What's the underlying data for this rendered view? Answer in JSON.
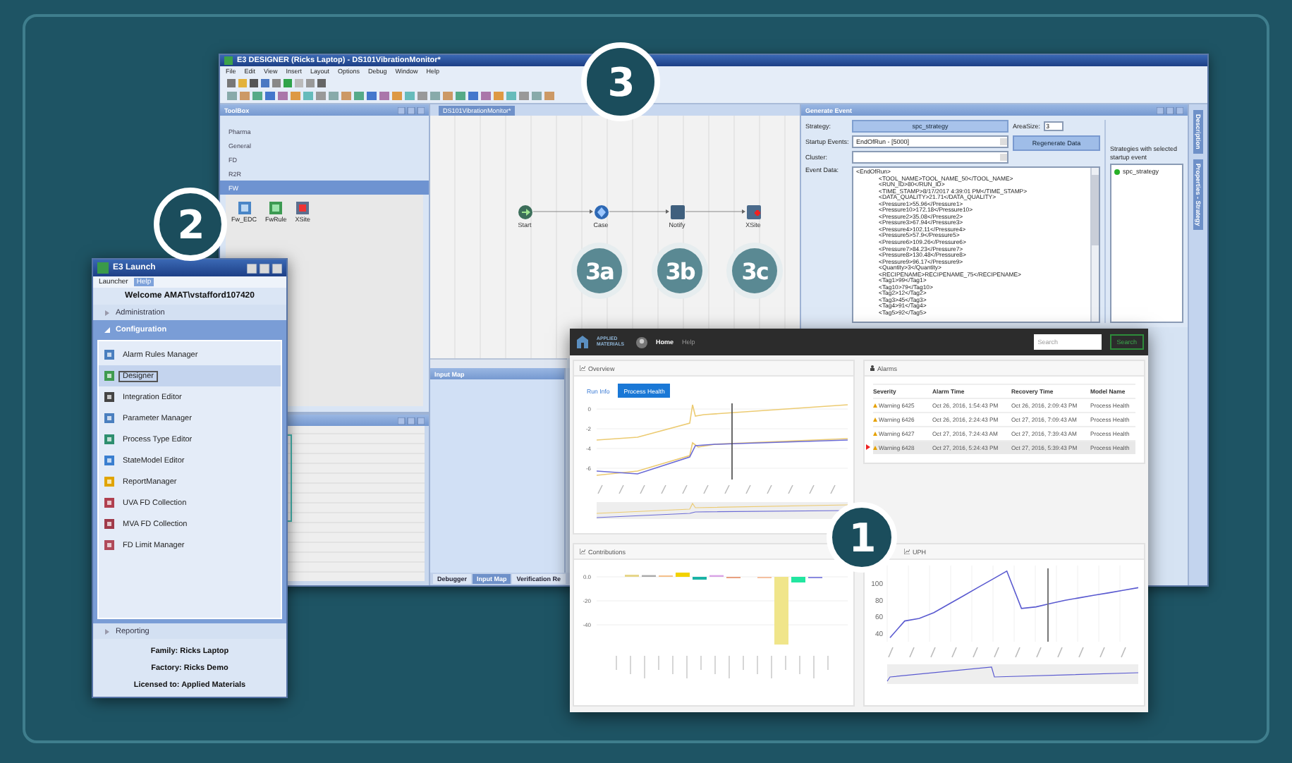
{
  "callouts": [
    {
      "label": "3",
      "kind": "major"
    },
    {
      "label": "3a",
      "kind": "minor"
    },
    {
      "label": "3b",
      "kind": "minor"
    },
    {
      "label": "3c",
      "kind": "minor"
    },
    {
      "label": "2",
      "kind": "major"
    },
    {
      "label": "1",
      "kind": "major"
    }
  ],
  "designer": {
    "title": "E3 DESIGNER (Ricks Laptop) - DS101VibrationMonitor*",
    "menu": [
      "File",
      "Edit",
      "View",
      "Insert",
      "Layout",
      "Options",
      "Debug",
      "Window",
      "Help"
    ],
    "toolbox": {
      "title": "ToolBox",
      "categories": [
        {
          "label": "Pharma",
          "selected": false
        },
        {
          "label": "General",
          "selected": false
        },
        {
          "label": "FD",
          "selected": false
        },
        {
          "label": "R2R",
          "selected": false
        },
        {
          "label": "FW",
          "selected": true
        }
      ],
      "tools": [
        "Fw_EDC",
        "FwRule",
        "XSite"
      ]
    },
    "canvas": {
      "tab": "DS101VibrationMonitor*",
      "nodes": [
        {
          "label": "Start",
          "kind": "start"
        },
        {
          "label": "Case",
          "kind": "case"
        },
        {
          "label": "Notify",
          "kind": "notify"
        },
        {
          "label": "XSite",
          "kind": "xsite"
        }
      ]
    },
    "generate_event": {
      "title": "Generate Event",
      "strategy_label": "Strategy:",
      "strategy": "spc_strategy",
      "startup_label": "Startup Events:",
      "startup_value": "EndOfRun - [5000]",
      "cluster_label": "Cluster:",
      "area_label": "AreaSize:",
      "area_value": "3",
      "regenerate": "Regenerate Data",
      "event_label": "Event Data:",
      "event_lines": [
        "<EndOfRun>",
        "<TOOL_NAME>TOOL_NAME_50</TOOL_NAME>",
        "<RUN_ID>80</RUN_ID>",
        "<TIME_STAMP>8/17/2017 4:39:01 PM</TIME_STAMP>",
        "<DATA_QUALITY>21.71</DATA_QUALITY>",
        "<Pressure1>55.96</Pressure1>",
        "<Pressure10>172.18</Pressure10>",
        "<Pressure2>35.08</Pressure2>",
        "<Pressure3>67.94</Pressure3>",
        "<Pressure4>102.11</Pressure4>",
        "<Pressure5>57.9</Pressure5>",
        "<Pressure6>109.26</Pressure6>",
        "<Pressure7>84.23</Pressure7>",
        "<Pressure8>130.48</Pressure8>",
        "<Pressure9>96.17</Pressure9>",
        "<Quantity>3</Quantity>",
        "<RECIPENAME>RECIPENAME_75</RECIPENAME>",
        "<Tag1>99</Tag1>",
        "<Tag10>79</Tag10>",
        "<Tag2>12</Tag2>",
        "<Tag3>45</Tag3>",
        "<Tag4>91</Tag4>",
        "<Tag5>92</Tag5>"
      ],
      "strategies_caption": "Strategies with selected startup event",
      "strategies": [
        "spc_strategy"
      ]
    },
    "side_tabs": [
      "Description",
      "Properties - Strategy"
    ],
    "input_map": {
      "title": "Input Map"
    },
    "bottom_tabs": [
      {
        "label": "Debugger",
        "selected": false
      },
      {
        "label": "Input Map",
        "selected": true
      },
      {
        "label": "Verification Re",
        "selected": false
      }
    ]
  },
  "launcher": {
    "title": "E3 Launch",
    "menu": [
      {
        "label": "Launcher",
        "selected": false
      },
      {
        "label": "Help",
        "selected": true
      }
    ],
    "welcome": "Welcome AMAT\\vstafford107420",
    "sections": [
      {
        "label": "Administration",
        "expanded": false
      },
      {
        "label": "Configuration",
        "expanded": true,
        "items": [
          {
            "label": "Alarm Rules Manager",
            "selected": false
          },
          {
            "label": "Designer",
            "selected": true
          },
          {
            "label": "Integration Editor",
            "selected": false
          },
          {
            "label": "Parameter Manager",
            "selected": false
          },
          {
            "label": "Process Type Editor",
            "selected": false
          },
          {
            "label": "StateModel Editor",
            "selected": false
          },
          {
            "label": "ReportManager",
            "selected": false
          },
          {
            "label": "UVA FD Collection",
            "selected": false
          },
          {
            "label": "MVA FD Collection",
            "selected": false
          },
          {
            "label": "FD Limit Manager",
            "selected": false
          }
        ]
      },
      {
        "label": "Reporting",
        "expanded": false
      }
    ],
    "footer": [
      "Family: Ricks Laptop",
      "Factory: Ricks Demo",
      "Licensed to: Applied Materials"
    ]
  },
  "dashboard": {
    "brand": "APPLIED MATERIALS",
    "nav": [
      {
        "label": "Home",
        "selected": true
      },
      {
        "label": "Help",
        "selected": false
      }
    ],
    "search": {
      "placeholder": "Search"
    },
    "search_button": "Search",
    "overview": {
      "title": "Overview",
      "tabs": [
        {
          "label": "Run Info",
          "selected": false
        },
        {
          "label": "Process Health",
          "selected": true
        }
      ],
      "y_ticks": [
        "0",
        "-2",
        "-4",
        "-6"
      ]
    },
    "alarms": {
      "title": "Alarms",
      "columns": [
        "Severity",
        "Alarm Time",
        "Recovery Time",
        "Model Name"
      ],
      "rows": [
        {
          "severity": "Warning 6425",
          "alarm_time": "Oct 26, 2016, 1:54:43 PM",
          "recovery_time": "Oct 26, 2016, 2:09:43 PM",
          "model": "Process Health",
          "selected": false
        },
        {
          "severity": "Warning 6426",
          "alarm_time": "Oct 26, 2016, 2:24:43 PM",
          "recovery_time": "Oct 27, 2016, 7:09:43 AM",
          "model": "Process Health",
          "selected": false
        },
        {
          "severity": "Warning 6427",
          "alarm_time": "Oct 27, 2016, 7:24:43 AM",
          "recovery_time": "Oct 27, 2016, 7:39:43 AM",
          "model": "Process Health",
          "selected": false
        },
        {
          "severity": "Warning 6428",
          "alarm_time": "Oct 27, 2016, 5:24:43 PM",
          "recovery_time": "Oct 27, 2016, 5:39:43 PM",
          "model": "Process Health",
          "selected": true
        }
      ]
    },
    "contributions": {
      "title": "Contributions",
      "y_ticks": [
        "0.0",
        "-20",
        "-40"
      ]
    },
    "uph": {
      "title": "UPH",
      "chart_data": {
        "type": "line",
        "categories": [
          null,
          null,
          null,
          null,
          null,
          null,
          null,
          null,
          null,
          null,
          null,
          null,
          null,
          null,
          null,
          null,
          null,
          null
        ],
        "series": [
          {
            "color": "#5a5ad0",
            "values": [
              35,
              55,
              58,
              65,
              75,
              85,
              95,
              105,
              115,
              70,
              72,
              76,
              80,
              83,
              86,
              89,
              92,
              95
            ]
          }
        ],
        "yticks": [
          {
            "value": 40,
            "label": "40"
          },
          {
            "value": 60,
            "label": "60"
          },
          {
            "value": 80,
            "label": "80"
          },
          {
            "value": 100,
            "label": "100"
          }
        ],
        "ylim": [
          30,
          120
        ]
      }
    }
  }
}
